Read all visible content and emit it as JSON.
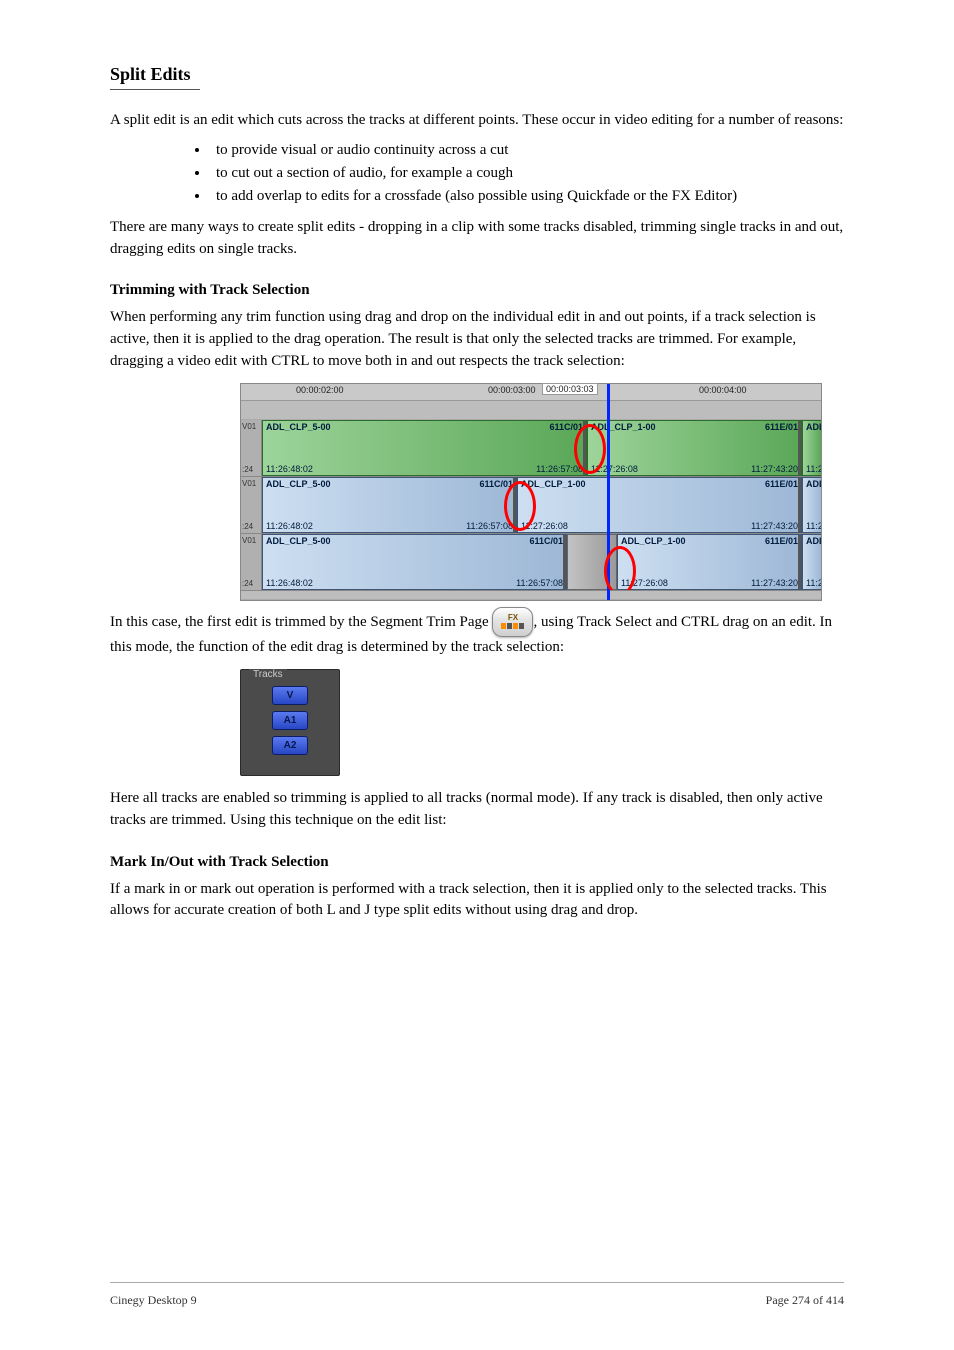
{
  "page": {
    "title": "Split Edits",
    "p1": "A split edit is an edit which cuts across the tracks at different points. These occur in video editing for a number of reasons:",
    "bullets": [
      "to provide visual or audio continuity across a cut",
      "to cut out a section of audio, for example a cough",
      "to add overlap to edits for a crossfade (also possible using Quickfade or the FX Editor)"
    ],
    "p2": "There are many ways to create split edits - dropping in a clip with some tracks disabled, trimming single tracks in and out, dragging edits on single tracks.",
    "h2_1": "Trimming with Track Selection",
    "p3": "When performing any trim function using drag and drop on the individual edit in and out points, if a track selection is active, then it is applied to the drag operation. The result is that only the selected tracks are trimmed. For example, dragging a video edit with CTRL to move both in and out respects the track selection:",
    "p4_before": "In this case, the first edit is trimmed by the Segment Trim Page ",
    "p4_after": ", using Track Select and CTRL drag on an edit. In this mode, the function of the edit drag is determined by the track selection:",
    "p5": "Here all tracks are enabled so trimming is applied to all tracks (normal mode). If any track is disabled, then only active tracks are trimmed. Using this technique on the edit list:",
    "h2_2": "Mark In/Out with Track Selection",
    "p6": "If a mark in or mark out operation is performed with a track selection, then it is applied only to the selected tracks. This allows for accurate creation of both L and J type split edits without using drag and drop.",
    "footer_left": "Cinegy Desktop 9",
    "footer_right": "Page 274 of 414"
  },
  "timeline": {
    "ruler": {
      "t1": "00:00:02:00",
      "t2": "00:00:03:00",
      "box": "00:00:03:03",
      "t3": "00:00:04:00"
    },
    "left": {
      "top": "V01",
      "bot": ":24"
    },
    "row1": {
      "c1": {
        "tl": "ADL_CLP_5-00",
        "tr": "611C/01",
        "bl": "11:26:48:02",
        "br": "11:26:57:08"
      },
      "c2": {
        "tl": "ADL_CLP_1-00",
        "tr": "611E/01",
        "bl": "11:27:26:08",
        "br": "11:27:43:20"
      },
      "c3": {
        "tl": "ADL",
        "bl": "11:2"
      }
    },
    "row2": {
      "c1": {
        "tl": "ADL_CLP_5-00",
        "tr": "611C/01",
        "bl": "11:26:48:02",
        "br": "11:26:57:08"
      },
      "c2": {
        "tl": "ADL_CLP_1-00",
        "tr": "611E/01",
        "bl": "11:27:26:08",
        "br": "11:27:43:20"
      },
      "c3": {
        "tl": "ADL",
        "bl": "11:2"
      }
    },
    "row3": {
      "c1": {
        "tl": "ADL_CLP_5-00",
        "tr": "611C/01",
        "bl": "11:26:48:02",
        "br": "11:26:57:08"
      },
      "c2": {
        "tl": "ADL_CLP_1-00",
        "tr": "611E/01",
        "bl": "11:27:26:08",
        "br": "11:27:43:20"
      },
      "c3": {
        "tl": "ADL",
        "bl": "11:2"
      }
    }
  },
  "fx": {
    "label": "FX"
  },
  "tracks": {
    "legend": "Tracks",
    "v": "V",
    "a1": "A1",
    "a2": "A2"
  }
}
